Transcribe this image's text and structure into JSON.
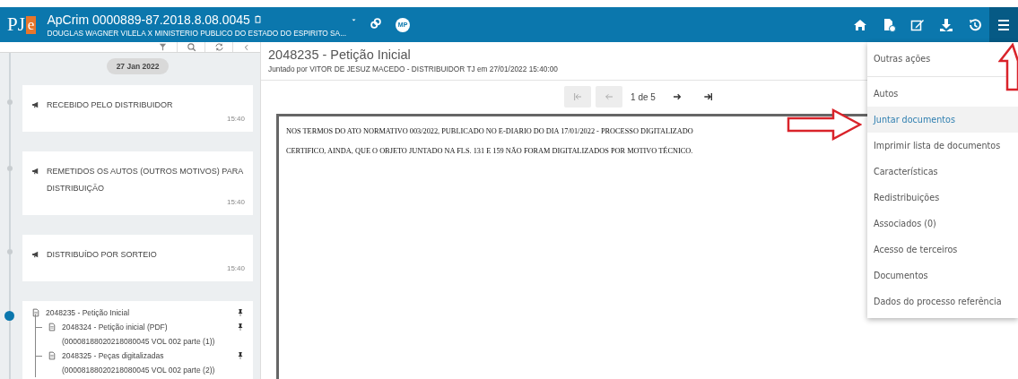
{
  "header": {
    "logo": {
      "text": "PJ",
      "badge": "e"
    },
    "title": "ApCrim 0000889-87.2018.8.08.0045",
    "subtitle": "DOUGLAS WAGNER VILELA X MINISTERIO PUBLICO DO ESTADO DO ESPIRITO SA...",
    "badge": "MP",
    "menu_open": true
  },
  "timeline": {
    "date": "27 Jan 2022",
    "items": [
      {
        "kind": "event",
        "text": "RECEBIDO PELO DISTRIBUIDOR",
        "time": "15:40",
        "selected": false
      },
      {
        "kind": "event",
        "text": "REMETIDOS OS AUTOS (OUTROS MOTIVOS) PARA DISTRIBUIÇÃO",
        "time": "15:40",
        "selected": false
      },
      {
        "kind": "event",
        "text": "DISTRIBUÍDO POR SORTEIO",
        "time": "15:40",
        "selected": false
      },
      {
        "kind": "document",
        "text": "2048235 - Petição Inicial",
        "selected": true,
        "children": [
          {
            "text": "2048324 - Petição inicial (PDF) (00008188020218080045 VOL 002 parte (1))"
          },
          {
            "text": "2048325 - Peças digitalizadas (00008188020218080045 VOL 002 parte (2))"
          }
        ]
      }
    ]
  },
  "document": {
    "title": "2048235 - Petição Inicial",
    "subtitle": "Juntado por VITOR DE JESUZ MACEDO - DISTRIBUIDOR TJ em 27/01/2022 15:40:00",
    "pager": {
      "text": "1 de 5",
      "first_disabled": true,
      "last_disabled": false
    },
    "lines": [
      "NOS TERMOS DO ATO NORMATIVO 003/2022, PUBLICADO NO E-DIARIO DO DIA 17/01/2022 - PROCESSO DIGITALIZADO",
      "CERTIFICO, AINDA, QUE O OBJETO JUNTADO NA FLS. 131 E 159 NÃO FORAM DIGITALIZADOS POR MOTIVO TÉCNICO."
    ]
  },
  "menu": {
    "heading": "Outras ações",
    "items": [
      {
        "label": "Autos",
        "selected": false
      },
      {
        "label": "Juntar documentos",
        "selected": true
      },
      {
        "label": "Imprimir lista de documentos",
        "selected": false
      },
      {
        "label": "Características",
        "selected": false
      },
      {
        "label": "Redistribuições",
        "selected": false
      },
      {
        "label": "Associados (0)",
        "selected": false
      },
      {
        "label": "Acesso de terceiros",
        "selected": false
      },
      {
        "label": "Documentos",
        "selected": false
      },
      {
        "label": "Dados do processo referência",
        "selected": false
      }
    ]
  }
}
